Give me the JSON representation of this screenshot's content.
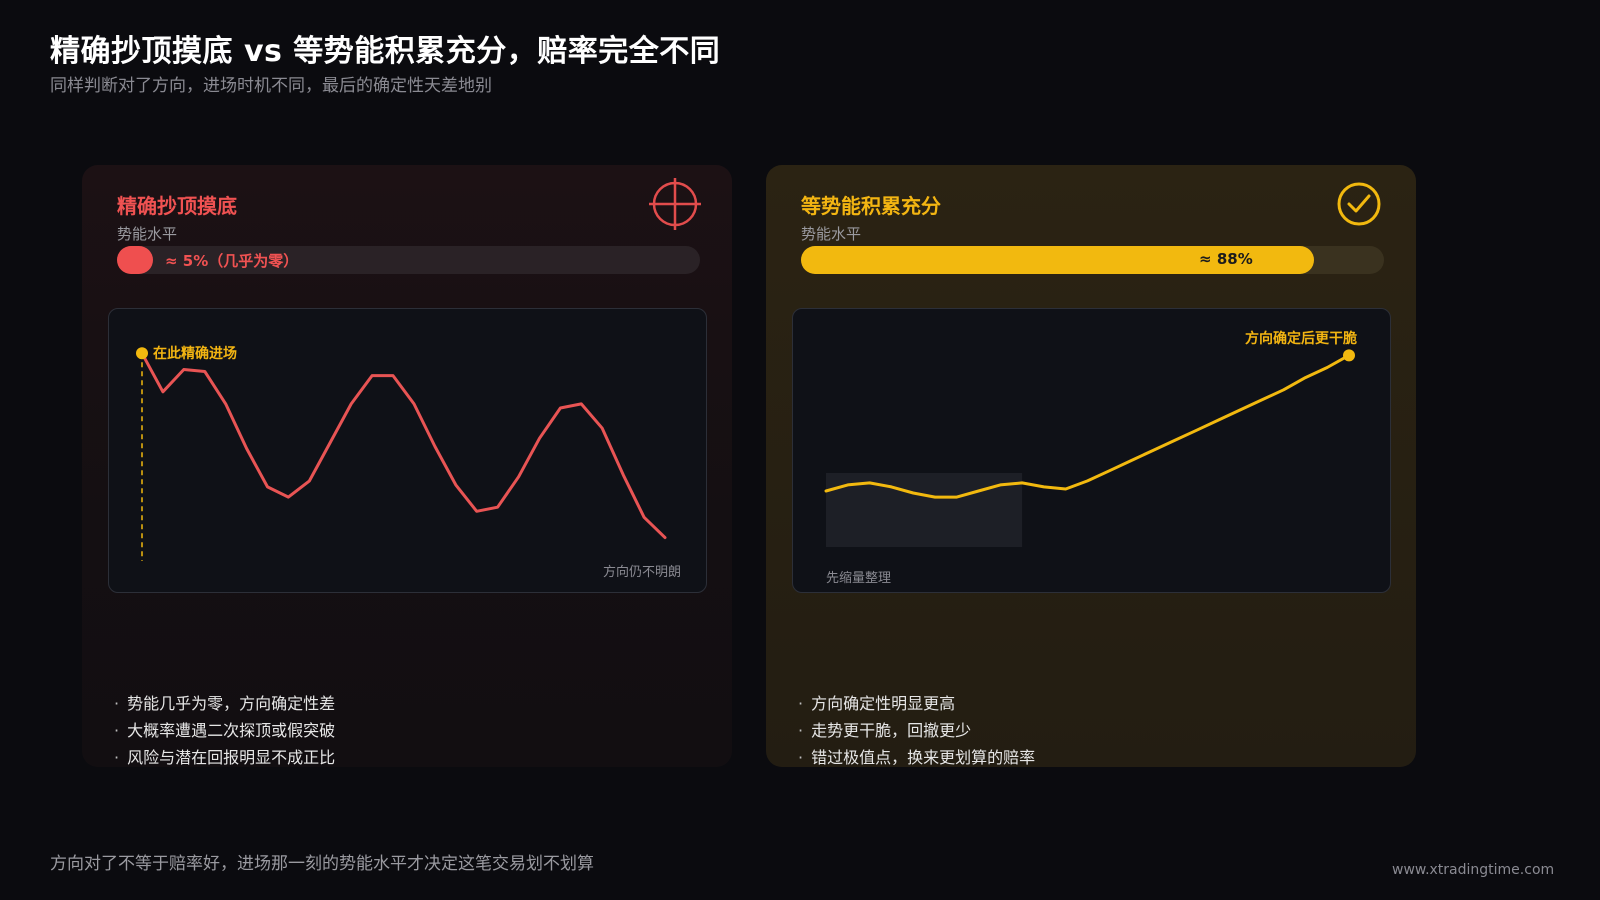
{
  "header": {
    "title": "精确抄顶摸底 vs 等势能积累充分，赔率完全不同",
    "subtitle": "同样判断对了方向，进场时机不同，最后的确定性天差地别"
  },
  "colors": {
    "background": "#0b0b0f",
    "red_accent": "#f05252",
    "yellow_accent": "#f2b90f"
  },
  "left_card": {
    "title": "精确抄顶摸底",
    "icon": "crosshair-icon",
    "level_label": "势能水平",
    "level_value": 0.05,
    "level_text": "≈ 5%（几乎为零）",
    "chart_callout": "在此精确进场",
    "chart_note": "方向仍不明朗",
    "bullets": [
      "势能几乎为零，方向确定性差",
      "大概率遭遇二次探顶或假突破",
      "风险与潜在回报明显不成正比"
    ]
  },
  "right_card": {
    "title": "等势能积累充分",
    "icon": "check-circle-icon",
    "level_label": "势能水平",
    "level_value": 0.88,
    "level_text": "≈ 88%",
    "chart_callout": "方向确定后更干脆",
    "chart_note": "先缩量整理",
    "bullets": [
      "方向确定性明显更高",
      "走势更干脆，回撤更少",
      "错过极值点，换来更划算的赔率"
    ]
  },
  "footer": {
    "text": "方向对了不等于赔率好，进场那一刻的势能水平才决定这笔交易划不划算",
    "url": "www.xtradingtime.com"
  },
  "chart_data": [
    {
      "type": "line",
      "series": [
        {
          "values": [
            88,
            69,
            80,
            79,
            63,
            41,
            22,
            17,
            25,
            44,
            63,
            77,
            77,
            63,
            42,
            23,
            10,
            12,
            27,
            46,
            61,
            63,
            51,
            28,
            7,
            -3
          ]
        }
      ],
      "ylim": [
        -20,
        100
      ],
      "annotations": [
        "在此精确进场",
        "方向仍不明朗"
      ]
    },
    {
      "type": "line",
      "series": [
        {
          "values": [
            20,
            23,
            24,
            22,
            19,
            17,
            17,
            20,
            23,
            24,
            22,
            21,
            25,
            30,
            35,
            40,
            45,
            50,
            55,
            60,
            65,
            70,
            76,
            81,
            87
          ]
        }
      ],
      "ylim": [
        -20,
        100
      ],
      "annotations": [
        "方向确定后更干脆",
        "先缩量整理"
      ]
    }
  ]
}
